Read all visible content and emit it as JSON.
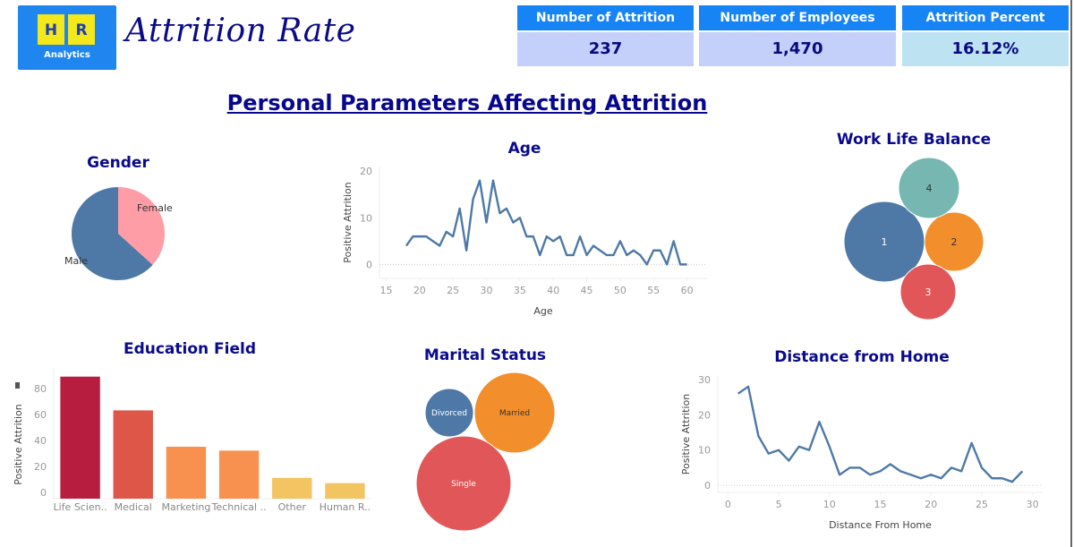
{
  "header": {
    "logo": {
      "letter1": "H",
      "letter2": "R",
      "subtitle": "Analytics"
    },
    "title": "Attrition Rate"
  },
  "kpis": [
    {
      "label": "Number of Attrition",
      "value": "237"
    },
    {
      "label": "Number of Employees",
      "value": "1,470"
    },
    {
      "label": "Attrition Percent",
      "value": "16.12%"
    }
  ],
  "main_title": "Personal Parameters Affecting Attrition",
  "colors": {
    "blue": "#4e79a7",
    "orange": "#f28e2b",
    "red": "#e15759",
    "teal": "#76b7b2",
    "pink": "#ff9da7",
    "title": "#0a0a8c",
    "kpi_header": "#1784f5"
  },
  "chart_data": [
    {
      "id": "gender",
      "type": "pie",
      "title": "Gender",
      "categories": [
        "Female",
        "Male"
      ],
      "values": [
        87,
        150
      ],
      "colors": [
        "#ff9da7",
        "#4e79a7"
      ]
    },
    {
      "id": "age",
      "type": "line",
      "title": "Age",
      "xlabel": "Age",
      "ylabel": "Positive Attrition",
      "xlim": [
        14,
        63
      ],
      "ylim": [
        -3,
        21
      ],
      "xticks": [
        15,
        20,
        25,
        30,
        35,
        40,
        45,
        50,
        55,
        60
      ],
      "yticks": [
        0,
        10,
        20
      ],
      "x": [
        18,
        19,
        20,
        21,
        22,
        23,
        24,
        25,
        26,
        27,
        28,
        29,
        30,
        31,
        32,
        33,
        34,
        35,
        36,
        37,
        38,
        39,
        40,
        41,
        42,
        43,
        44,
        45,
        46,
        47,
        48,
        49,
        50,
        51,
        52,
        53,
        54,
        55,
        56,
        57,
        58,
        59,
        60
      ],
      "values": [
        4,
        6,
        6,
        6,
        5,
        4,
        7,
        6,
        12,
        3,
        14,
        18,
        9,
        18,
        11,
        12,
        9,
        10,
        6,
        6,
        2,
        6,
        5,
        6,
        2,
        2,
        6,
        2,
        4,
        3,
        2,
        2,
        5,
        2,
        3,
        2,
        0,
        3,
        3,
        0,
        5,
        0,
        0
      ],
      "color": "#4e79a7"
    },
    {
      "id": "work_life_balance",
      "type": "bubble",
      "title": "Work Life Balance",
      "categories": [
        "1",
        "2",
        "3",
        "4"
      ],
      "values": [
        127,
        58,
        55,
        27
      ],
      "colors": [
        "#4e79a7",
        "#f28e2b",
        "#e15759",
        "#76b7b2"
      ]
    },
    {
      "id": "education_field",
      "type": "bar",
      "title": "Education Field",
      "ylabel": "Positive Attrition",
      "categories": [
        "Life Scien..",
        "Medical",
        "Marketing",
        "Technical ..",
        "Other",
        "Human R.."
      ],
      "values": [
        89,
        63,
        35,
        32,
        11,
        7
      ],
      "ylim": [
        -5,
        95
      ],
      "yticks": [
        0,
        20,
        40,
        60,
        80
      ],
      "colors": [
        "#b61d3e",
        "#dd5648",
        "#f8904f",
        "#f8904f",
        "#f2c462",
        "#f2c462"
      ]
    },
    {
      "id": "marital_status",
      "type": "bubble",
      "title": "Marital Status",
      "categories": [
        "Divorced",
        "Married",
        "Single"
      ],
      "values": [
        33,
        84,
        120
      ],
      "colors": [
        "#4e79a7",
        "#f28e2b",
        "#e15759"
      ]
    },
    {
      "id": "distance_from_home",
      "type": "line",
      "title": "Distance from Home",
      "xlabel": "Distance From Home",
      "ylabel": "Positive Attrition",
      "xlim": [
        -1,
        31
      ],
      "ylim": [
        -2,
        31
      ],
      "xticks": [
        0,
        5,
        10,
        15,
        20,
        25,
        30
      ],
      "yticks": [
        0,
        10,
        20,
        30
      ],
      "x": [
        1,
        2,
        3,
        4,
        5,
        6,
        7,
        8,
        9,
        10,
        11,
        12,
        13,
        14,
        15,
        16,
        17,
        18,
        19,
        20,
        21,
        22,
        23,
        24,
        25,
        26,
        27,
        28,
        29
      ],
      "values": [
        26,
        28,
        14,
        9,
        10,
        7,
        11,
        10,
        18,
        11,
        3,
        5,
        5,
        3,
        4,
        6,
        4,
        3,
        2,
        3,
        2,
        5,
        4,
        12,
        5,
        2,
        2,
        1,
        4
      ],
      "color": "#4e79a7"
    }
  ]
}
